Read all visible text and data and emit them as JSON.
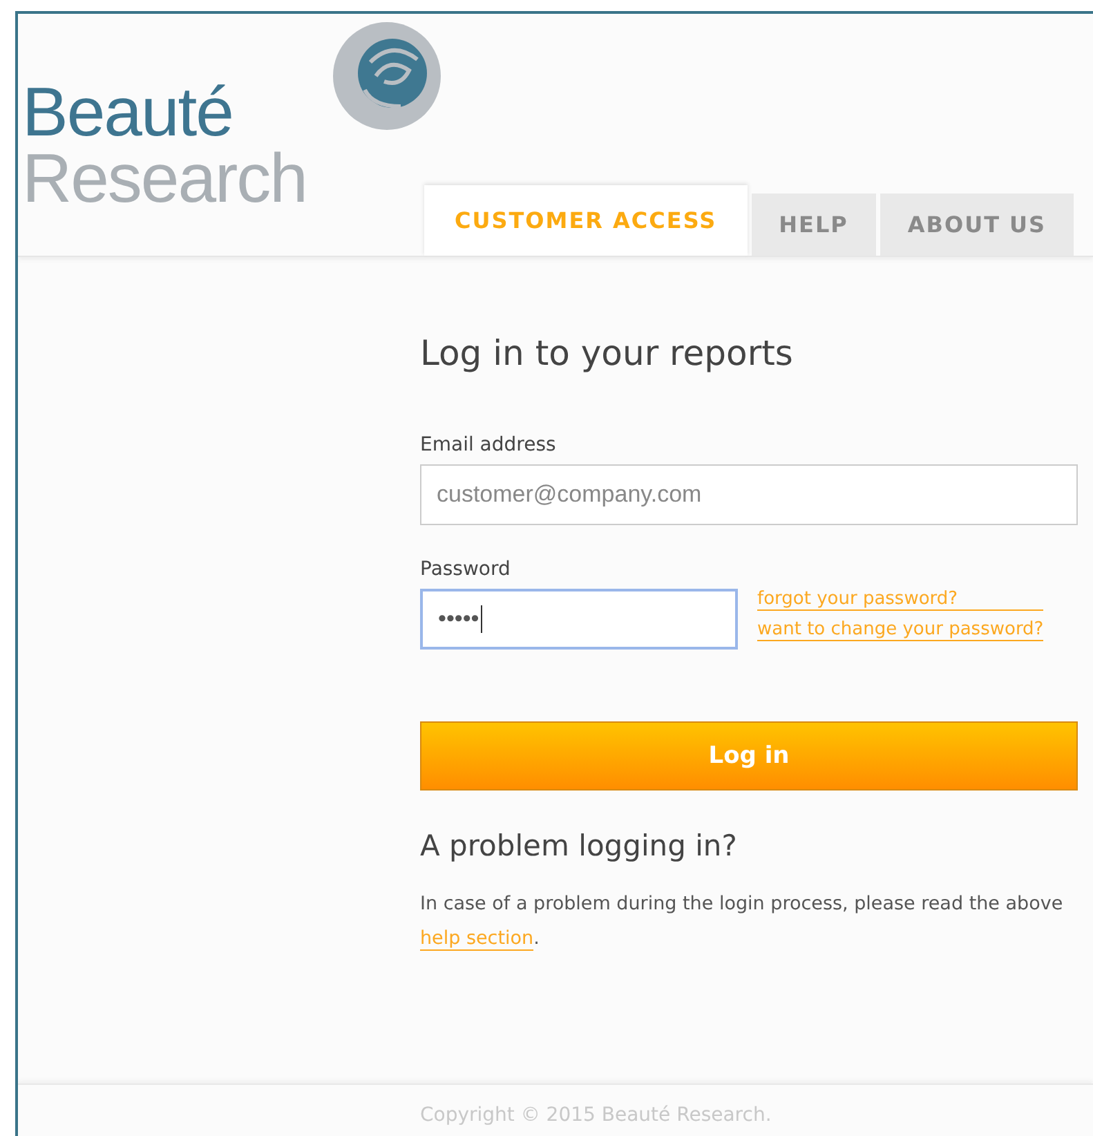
{
  "logo": {
    "line_1": "Beauté",
    "line_2": "Research"
  },
  "tabs": [
    {
      "label": "CUSTOMER ACCESS",
      "selected": true
    },
    {
      "label": "HELP",
      "selected": false
    },
    {
      "label": "ABOUT US",
      "selected": false
    }
  ],
  "login": {
    "heading": "Log in to your reports",
    "email": {
      "label": "Email address",
      "placeholder": "customer@company.com"
    },
    "password": {
      "label": "Password",
      "value": "•••••",
      "focused": true
    },
    "links": [
      "forgot your password?",
      "want to change your password?"
    ],
    "button": "Log in"
  },
  "problem": {
    "heading": "A problem logging in?",
    "text_before": "In case of a problem during the login process, please read the above",
    "link": "help section",
    "text_after": "."
  },
  "footer": {
    "copyright": "Copyright © 2015 Beauté Research."
  }
}
